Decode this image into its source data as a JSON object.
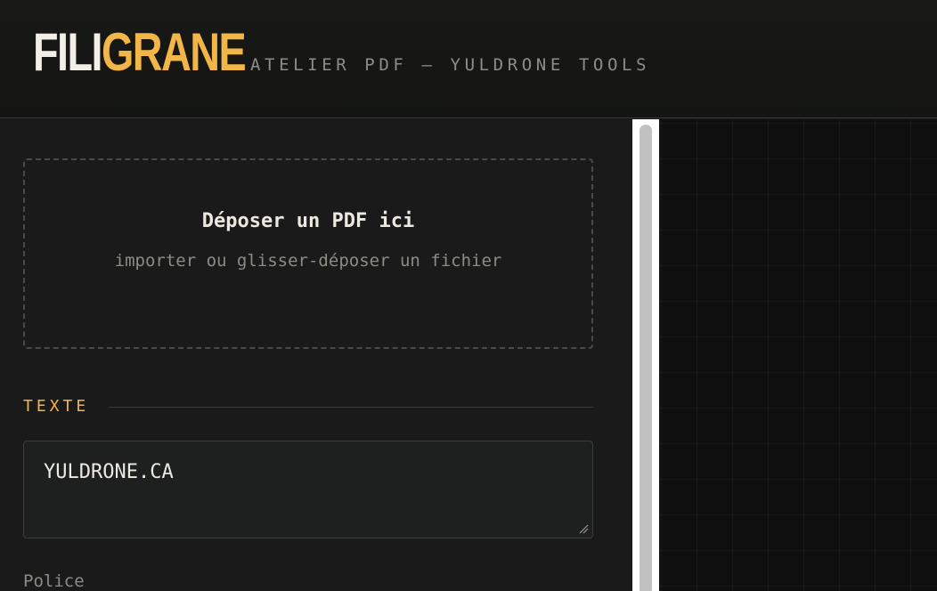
{
  "header": {
    "logo_part1": "FILI",
    "logo_part2": "GRANE",
    "subtitle": "ATELIER PDF — YULDRONE TOOLS"
  },
  "dropzone": {
    "title": "Déposer un PDF ici",
    "subtitle": "importer ou glisser-déposer un fichier"
  },
  "text_section": {
    "label": "TEXTE",
    "value": "YULDRONE.CA"
  },
  "font_section": {
    "label": "Police"
  },
  "colors": {
    "accent": "#f2b548",
    "background": "#141514",
    "panel": "#191a19",
    "text": "#ece9e1",
    "muted": "#8c8c87"
  }
}
